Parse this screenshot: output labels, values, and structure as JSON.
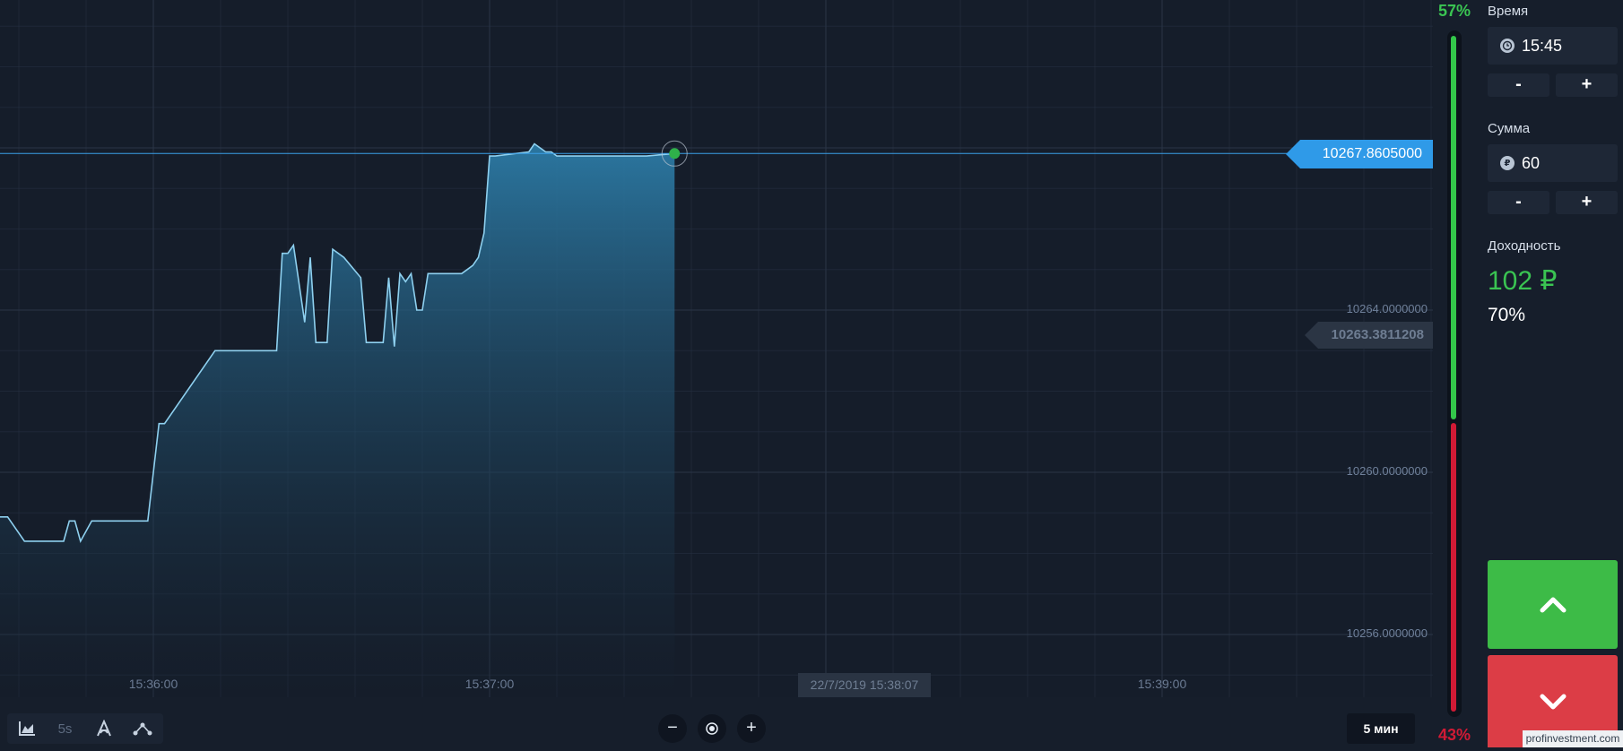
{
  "chart": {
    "price_labels": [
      "10264.0000000",
      "10260.0000000",
      "10256.0000000"
    ],
    "time_labels": [
      "15:36:00",
      "15:37:00",
      "15:39:00"
    ],
    "current_date": "22/7/2019 15:38:07",
    "current_price": "10267.8605000",
    "previous_price": "10263.3811208"
  },
  "chart_data": {
    "type": "area",
    "x": [
      "15:35:30",
      "15:35:34",
      "15:35:37",
      "15:35:44",
      "15:35:45",
      "15:35:46",
      "15:35:47",
      "15:35:49",
      "15:35:55",
      "15:35:56",
      "15:35:57",
      "15:35:59",
      "15:36:01",
      "15:36:02",
      "15:36:11",
      "15:36:12",
      "15:36:14",
      "15:36:16",
      "15:36:17",
      "15:36:18",
      "15:36:19",
      "15:36:20",
      "15:36:21",
      "15:36:22",
      "15:36:23",
      "15:36:24",
      "15:36:25",
      "15:36:27",
      "15:36:28",
      "15:36:29",
      "15:36:30",
      "15:36:31",
      "15:36:32",
      "15:36:34",
      "15:36:37",
      "15:36:38",
      "15:36:39",
      "15:36:40",
      "15:36:41",
      "15:36:42",
      "15:36:43",
      "15:36:44",
      "15:36:45",
      "15:36:46",
      "15:36:47",
      "15:36:48",
      "15:36:49",
      "15:36:54",
      "15:36:55",
      "15:36:56",
      "15:36:57",
      "15:36:58",
      "15:36:59",
      "15:37:00",
      "15:37:01",
      "15:37:07",
      "15:37:08",
      "15:37:09",
      "15:37:10",
      "15:37:11",
      "15:37:12",
      "15:37:14",
      "15:37:15",
      "15:37:16",
      "15:37:17",
      "15:37:19",
      "15:37:21",
      "15:37:22",
      "15:37:23",
      "15:37:24",
      "15:37:27",
      "15:37:28",
      "15:37:33"
    ],
    "y": [
      10258.9,
      10258.9,
      10258.3,
      10258.3,
      10258.8,
      10258.8,
      10258.3,
      10258.8,
      10258.8,
      10258.8,
      10258.8,
      10258.8,
      10261.2,
      10261.2,
      10263.0,
      10263.0,
      10263.0,
      10263.0,
      10263.0,
      10263.0,
      10263.0,
      10263.0,
      10263.0,
      10263.0,
      10265.4,
      10265.4,
      10265.6,
      10263.7,
      10265.3,
      10263.2,
      10263.2,
      10263.2,
      10265.5,
      10265.3,
      10264.8,
      10263.2,
      10263.2,
      10263.2,
      10263.2,
      10264.8,
      10263.1,
      10264.9,
      10264.7,
      10264.9,
      10264.0,
      10264.0,
      10264.9,
      10264.9,
      10264.9,
      10265.0,
      10265.1,
      10265.3,
      10265.9,
      10267.8,
      10267.8,
      10267.9,
      10268.1,
      10268.0,
      10267.9,
      10267.9,
      10267.8,
      10267.8,
      10267.8,
      10267.8,
      10267.8,
      10267.8,
      10267.8,
      10267.8,
      10267.8,
      10267.8,
      10267.8,
      10267.8,
      10267.8605
    ],
    "ylim": [
      10255.0,
      10271.5
    ],
    "grid": true
  },
  "toolbar": {
    "interval_label": "5s",
    "zoom_out": "−",
    "zoom_in": "+",
    "timeframe": "5 мин"
  },
  "sentiment": {
    "up_pct": "57%",
    "down_pct": "43%",
    "up_value": 57,
    "down_value": 43
  },
  "panel": {
    "time_label": "Время",
    "time_value": "15:45",
    "amount_label": "Сумма",
    "amount_value": "60",
    "currency_icon_char": "₽",
    "minus": "-",
    "plus": "+",
    "payout_label": "Доходность",
    "payout_amount": "102 ₽",
    "payout_pct": "70%"
  },
  "watermark": "profinvestment.com",
  "colors": {
    "up": "#3dbb47",
    "down": "#dc3d46",
    "line": "#8ed0ef",
    "price_tag": "#2f9ae8"
  }
}
